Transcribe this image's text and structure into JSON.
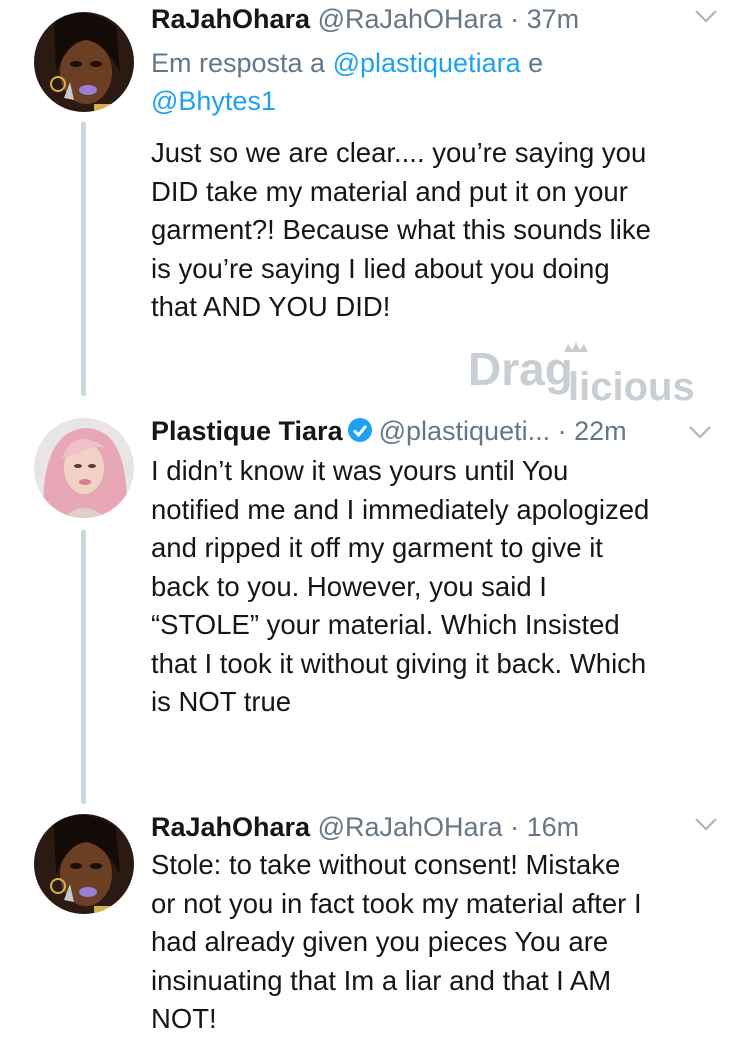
{
  "tweets": [
    {
      "name": "RaJahOhara",
      "handle": "@RaJahOHara",
      "separator": "·",
      "time": "37m",
      "reply_prefix": "Em resposta a ",
      "reply_user1": "@plastiquetiara",
      "reply_joiner": " e ",
      "reply_user2": "@Bhytes1",
      "text": "Just so we are clear.... you’re saying you\nDID take my material and put it on your\ngarment?!  Because what this sounds like\nis you’re saying I lied about you doing\nthat AND YOU DID!"
    },
    {
      "name": "Plastique Tiara",
      "handle": "@plastiqueti...",
      "separator": "·",
      "time": "22m",
      "verified": true,
      "text": "I didn’t know it was yours until You\nnotified me and I immediately apologized\nand ripped it off my garment to give it\nback to you. However, you said I\n“STOLE” your material. Which Insisted\nthat I took it without giving it back. Which\nis NOT true"
    },
    {
      "name": "RaJahOhara",
      "handle": "@RaJahOHara",
      "separator": "·",
      "time": "16m",
      "text": "Stole: to take without consent! Mistake\nor not you in fact took my material after I\nhad already given you pieces You are\ninsinuating that Im a liar and that I AM\nNOT!"
    }
  ],
  "watermark": {
    "text_a": "Drag",
    "text_b": "licious"
  },
  "colors": {
    "link": "#1da1f2",
    "muted": "#657786",
    "thread_line": "#ccd6dd",
    "verified": "#1da1f2"
  },
  "icons": [
    "chevron-down-icon",
    "verified-badge-icon"
  ]
}
